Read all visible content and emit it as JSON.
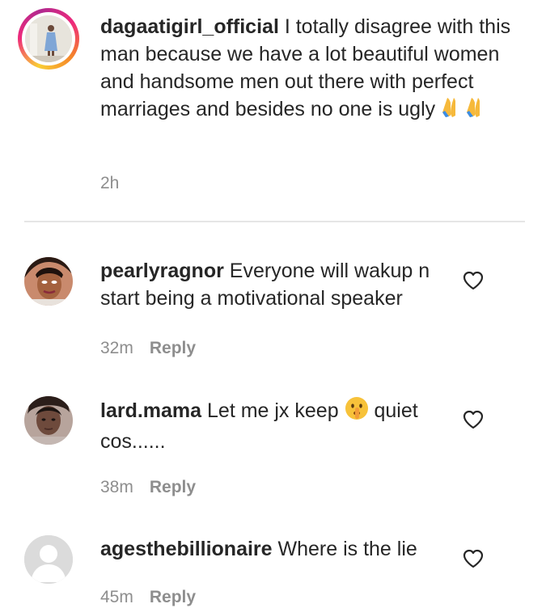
{
  "main_comment": {
    "username": "dagaatigirl_official",
    "text": " I totally disagree with this man because we have a lot beautiful women and handsome men out there with perfect marriages and besides no one is ugly ",
    "time": "2h"
  },
  "replies": [
    {
      "username": "pearlyragnor",
      "text": " Everyone will wakup n start being a motivational speaker",
      "time": "32m",
      "reply_label": "Reply"
    },
    {
      "username": "lard.mama",
      "text_before": " Let me jx keep ",
      "text_after": " quiet cos......",
      "time": "38m",
      "reply_label": "Reply"
    },
    {
      "username": "agesthebillionaire",
      "text": " Where is the lie",
      "time": "45m",
      "reply_label": "Reply"
    }
  ],
  "icons": {
    "like": "heart-outline-icon",
    "prayer": "folded-hands-emoji",
    "quiet": "shushing-face-emoji"
  },
  "colors": {
    "text": "#262626",
    "meta": "#8e8e8e",
    "divider": "#e6e6e6",
    "story_ring_start": "#f9ce34",
    "story_ring_end": "#ee2a7b"
  }
}
